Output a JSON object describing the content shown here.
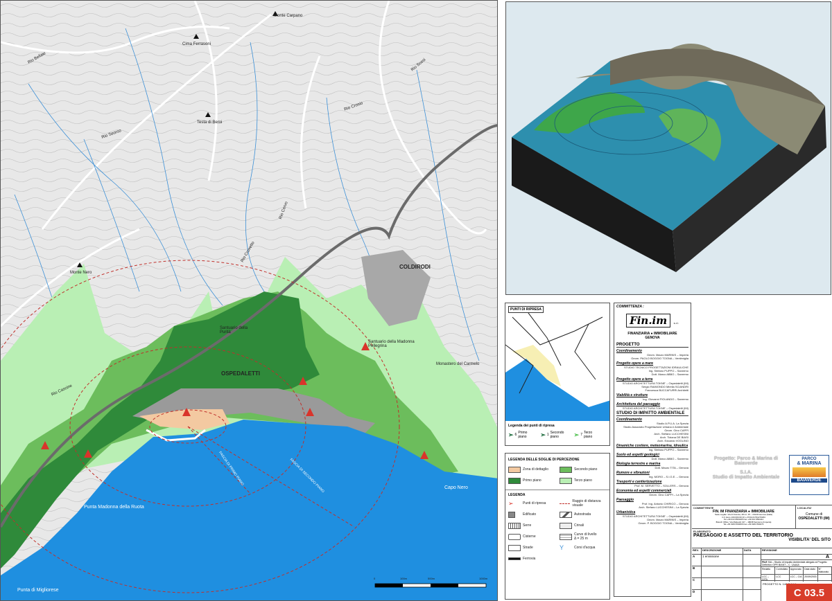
{
  "map": {
    "labels": {
      "monte_carpano": "Monte Carpano",
      "cima_ferrasoni": "Cima Ferrasoni",
      "testa_di_beroi": "Testa di Beroi",
      "monte_nero": "Monte Nero",
      "coldirodi": "COLDIRODI",
      "ospedaletti": "OSPEDALETTI",
      "santuario_purita": "Santuario della Purità",
      "santuario_madonna": "Santuario della Madonna Pellegrina",
      "monastero": "Monastero del Carmelo",
      "capo_nero": "Capo Nero",
      "punta_madonna": "Punta Madonna della Ruota",
      "punta_migliorese": "Punta di Migliorese",
      "rio_bellaie": "Rio Bellaie",
      "rio_seorso": "Rio Seorso",
      "rio_crosio": "Rio Crosio",
      "rio_cascine": "Rio Cascine",
      "rio_cervo": "Rio Cervo",
      "rio_sossi": "Rio Sossi",
      "rio_crovetto": "Rio Crovetto",
      "fascia_primo": "FASCIA DI PRIMO PIANO",
      "fascia_secondo": "FASCIA DI SECONDO PIANO"
    },
    "scale": [
      "0",
      "100m",
      "500m",
      "1000m"
    ]
  },
  "keymap": {
    "title": "PUNTI DI RIPRESA",
    "legend_title": "Legenda dei punti di ripresa",
    "items": [
      {
        "num": "6",
        "label": "Primo piano"
      },
      {
        "num": "1",
        "label": "Secondo piano"
      },
      {
        "num": "7",
        "label": "Terzo piano"
      }
    ]
  },
  "legend": {
    "perc_title": "LEGENDA DELLE SOGLIE DI PERCEZIONE",
    "perc": [
      {
        "label": "Zona di dettaglio",
        "color": "#f3c9a1"
      },
      {
        "label": "Secondo piano",
        "color": "#6cbd5c"
      },
      {
        "label": "Primo piano",
        "color": "#2f8a3a"
      },
      {
        "label": "Terzo piano",
        "color": "#b9efb4"
      }
    ],
    "title": "LEGENDA",
    "items": [
      {
        "label": "Punti di ripresa",
        "icon": "camera-point-icon"
      },
      {
        "label": "Raggio di distanza visuale",
        "icon": "dashed-radius-icon"
      },
      {
        "label": "Edificato",
        "icon": "building-icon"
      },
      {
        "label": "Autostrada",
        "icon": "highway-icon"
      },
      {
        "label": "Serre",
        "icon": "greenhouse-icon"
      },
      {
        "label": "Crinali",
        "icon": "ridge-icon"
      },
      {
        "label": "Cisterne",
        "icon": "tank-icon"
      },
      {
        "label": "Curve di livello Δ = 25 m",
        "icon": "contour-icon"
      },
      {
        "label": "Strade",
        "icon": "road-icon"
      },
      {
        "label": "Corsi d'acqua",
        "icon": "stream-icon"
      },
      {
        "label": "Ferrovia",
        "icon": "railway-icon"
      }
    ]
  },
  "committenza": {
    "header": "COMMITTENZA :",
    "logo": "Fin.im",
    "logo_sub": "s.r.l.",
    "company": "FINANZIARIA ● IMMOBILIARE",
    "city": "GENOVA",
    "sections": [
      {
        "title": "PROGETTO",
        "lines": []
      },
      {
        "title": "Coordinamento",
        "lines": [
          "Geom. Mauro MARINIS – Imperia",
          "Geom. PAOLO BOGGIO TOGNA – Ventimiglia"
        ]
      },
      {
        "title": "Progetto opere a mare",
        "lines": [
          "STUDIO TECNICO PROGETTAZIONI IDRAULICHE",
          "Ing. Stefano PUPPO – Sanremo",
          "Dott. Marco ABBO – Sanremo"
        ]
      },
      {
        "title": "Progetto opere a terra",
        "lines": [
          "STUDIO ARCHITETTURA TOKNE' – Ospedaletti (IM)",
          "Sergio RAIMONDO   Mirella SCIANDRI",
          "Francesca BUCCAFURRI   Architetti"
        ]
      },
      {
        "title": "Viabilità e strutture",
        "lines": [
          "Ing. Giovanni FIOLANDO – Sanremo"
        ]
      },
      {
        "title": "Architettura del paesaggio",
        "lines": [
          "STUDIO ARCHITETTURA TOKNE' – Ospedaletti (IM)"
        ]
      },
      {
        "title": "STUDIO DI IMPATTO AMBIENTALE",
        "lines": []
      },
      {
        "title": "Coordinamento",
        "lines": [
          "Studio A.P.U.A. La Spezia",
          "Studio Associato Progettazione Urbana e Ambientale",
          "Geom. Gino CAPPI",
          "Arch. Stefano LUCCHESINI",
          "Arch. Tiziana DE BIASI",
          "Arch. Edoardo VOGLINO"
        ]
      },
      {
        "title": "Dinamiche costiere, meteomarina, idraulica",
        "lines": [
          "Ing. Stefano PUPPO – Sanremo"
        ]
      },
      {
        "title": "Suolo ed aspetti geologici",
        "lines": [
          "Dott. Marco ABBO – Sanremo"
        ]
      },
      {
        "title": "Biologia terrestre e marina",
        "lines": [
          "Dott. Mauro TITA – Genova"
        ]
      },
      {
        "title": "Rumore e vibrazioni",
        "lines": [
          "Ing. MORO – S.I.G.E. – Genova"
        ]
      },
      {
        "title": "Trasporti e cantierizzazione",
        "lines": [
          "Prof. M. SERVETTO – SOLLERS – Genova"
        ]
      },
      {
        "title": "Economia ed aspetti commerciali",
        "lines": [
          "Geom. Gino CAPPI – La Spezia"
        ]
      },
      {
        "title": "Paesaggio",
        "lines": [
          "Prof. Ing. Antonio CHIRICO – Genova",
          "Arch. Stefano LUCCHESINI – La Spezia"
        ]
      },
      {
        "title": "Urbanistica",
        "lines": [
          "STUDIO ARCHITETTURA TOKNE' – Ospedaletti (IM)",
          "Geom. Mauro MARINIS – Imperia",
          "Geom. P. BOGGIO TOGNA – Ventimiglia"
        ]
      }
    ]
  },
  "cartiglio": {
    "project_line1": "Progetto: Parco & Marina di",
    "project_line2": "Baiaverde",
    "sia": "S.I.A.",
    "sia_full": "Studio di Impatto Ambientale",
    "logo_top": "PARCO",
    "logo_mid": "& MARINA",
    "logo_bottom": "BAIAVERDE",
    "committente_label": "COMMITTENTE",
    "committente": "FIN. IM FINANZIARIA ● IMMOBILIARE",
    "committente_info": [
      "Sede Legale: Via di Francia, 28 int. 15 – 16149 Genova (Italia)",
      "C.F. Euro 100.000,00   CF e P.IVA 01791270184",
      "Tel +39 010 6591105   Fax +39 010 6591111",
      "Branch Office: Via Matteotti 137 – 18038 Sanremo (Imperia)",
      "Tel +39 0184 590266   Fax +39 0184 590271"
    ],
    "localita_label": "LOCALITA'",
    "comune": "Comune di",
    "comune_name": "OSPEDALETTI (IM)",
    "elaborato_label": "ELABORATO",
    "elaborato_title": "PAESAGGIO E ASSETTO DEL TERRITORIO",
    "elaborato_sub": "VISIBILITA' DEL SITO",
    "rev_header": [
      "REV.",
      "DESCRIZIONE",
      "DATA",
      "REVISIONE"
    ],
    "rev_value": "A",
    "rows": [
      {
        "rev": "A",
        "desc": "1 emissione",
        "data": ""
      },
      {
        "rev": "B",
        "desc": "",
        "data": ""
      },
      {
        "rev": "C",
        "desc": "",
        "data": ""
      },
      {
        "rev": "D",
        "desc": "",
        "data": ""
      }
    ],
    "file_label": "FILE",
    "file_text": "SIA – Studio di Impatto Ambientale allegato al Progetto Definitivo OPR BIANT – C. 1AAAA",
    "meta_headers": [
      "Redatto",
      "Controllato",
      "Approvato",
      "Data stato",
      "N° elaborato"
    ],
    "meta_values": [
      "LCC – G/TA",
      "LCC",
      "LCC – C/A",
      "20/09/2003",
      ""
    ],
    "progetto_n_label": "PROGETTO N.",
    "progetto_n_value": "1/AVDAIAA",
    "code": "C 03.5"
  }
}
